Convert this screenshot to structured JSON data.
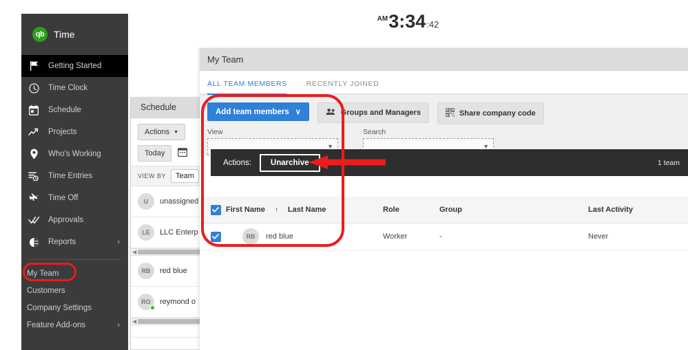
{
  "clock": {
    "ampm": "AM",
    "time": "3:34",
    "seconds": ":42"
  },
  "sidebar": {
    "brand": "Time",
    "logo_text": "qb",
    "logo_color": "#2ca01c",
    "items": [
      {
        "label": "Getting Started",
        "icon": "flag-icon",
        "active": true
      },
      {
        "label": "Time Clock",
        "icon": "clock-icon",
        "active": false
      },
      {
        "label": "Schedule",
        "icon": "calendar-icon",
        "active": false
      },
      {
        "label": "Projects",
        "icon": "trending-up-icon",
        "active": false
      },
      {
        "label": "Who's Working",
        "icon": "location-pin-icon",
        "active": false
      },
      {
        "label": "Time Entries",
        "icon": "time-entries-icon",
        "active": false
      },
      {
        "label": "Time Off",
        "icon": "airplane-icon",
        "active": false
      },
      {
        "label": "Approvals",
        "icon": "double-check-icon",
        "active": false
      },
      {
        "label": "Reports",
        "icon": "pie-chart-icon",
        "active": false,
        "chevron": "›"
      }
    ],
    "sub_items": [
      {
        "label": "My Team",
        "highlighted": true
      },
      {
        "label": "Customers",
        "highlighted": false
      },
      {
        "label": "Company Settings",
        "highlighted": false
      },
      {
        "label": "Feature Add-ons",
        "highlighted": false,
        "chevron": "›"
      }
    ]
  },
  "schedule_panel": {
    "title": "Schedule",
    "actions_label": "Actions",
    "actions_caret": "▼",
    "today_label": "Today",
    "calendar_icon": "calendar-icon",
    "view_by_label": "VIEW BY",
    "view_by_value": "Team",
    "people": [
      {
        "initials": "U",
        "name": "unassigned",
        "online": false
      },
      {
        "initials": "LE",
        "name": "LLC Enterp",
        "online": false
      },
      {
        "initials": "RB",
        "name": "red blue",
        "online": false
      },
      {
        "initials": "RO",
        "name": "reymond o",
        "online": true
      }
    ]
  },
  "team_panel": {
    "title": "My Team",
    "tabs": [
      {
        "label": "ALL TEAM MEMBERS",
        "active": true
      },
      {
        "label": "RECENTLY JOINED",
        "active": false
      }
    ],
    "buttons": {
      "add_team_members": "Add team members",
      "add_caret": "∨",
      "groups_and_managers": "Groups and Managers",
      "share_company_code": "Share company code"
    },
    "filters": [
      {
        "label": "View",
        "value": ""
      },
      {
        "label": "Search",
        "value": ""
      }
    ],
    "actions_bar": {
      "label": "Actions:",
      "unarchive_label": "Unarchive",
      "count": "1 team"
    },
    "table": {
      "columns": [
        "First Name",
        "Last Name",
        "Role",
        "Group",
        "Last Activity"
      ],
      "sort_indicator": "↑",
      "rows": [
        {
          "checked": true,
          "initials": "RB",
          "name": "red blue",
          "role": "Worker",
          "group": "-",
          "last_activity": "Never"
        }
      ],
      "header_checked": true
    }
  },
  "annotations": {
    "color": "#ee1b1b",
    "shapes": [
      {
        "type": "oval",
        "target": "my-team-sidebar-item"
      },
      {
        "type": "rounded-rect",
        "target": "team-toolbar-and-table"
      },
      {
        "type": "arrow",
        "target": "unarchive-button",
        "direction": "left"
      }
    ]
  }
}
